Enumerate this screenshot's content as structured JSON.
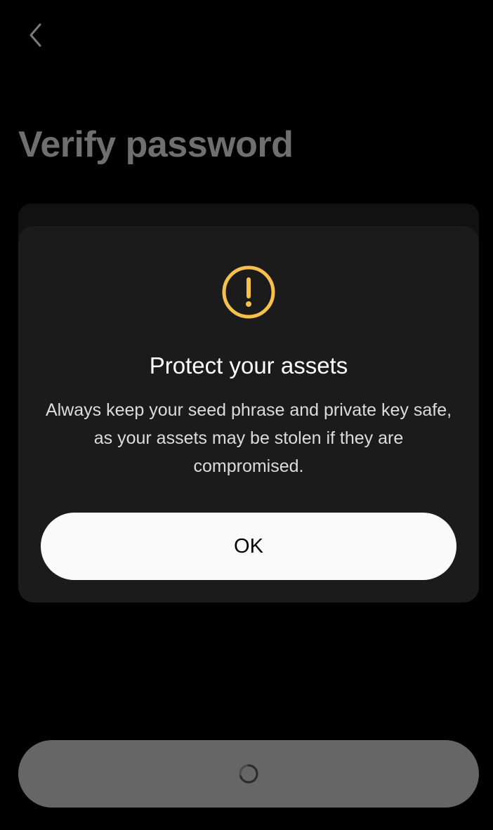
{
  "header": {
    "back_icon": "chevron-left-icon",
    "title": "Verify password"
  },
  "dialog": {
    "icon": "exclamation-circle-icon",
    "icon_color": "#F6C04F",
    "title": "Protect your assets",
    "message": "Always keep your seed phrase and private key safe, as your assets may be stolen if they are compromised.",
    "ok_label": "OK"
  },
  "footer": {
    "submit_state": "loading",
    "spinner_icon": "loading-spinner-icon"
  },
  "colors": {
    "background": "#000000",
    "dialog_background": "#1B1B1B",
    "title_dimmed": "#6F6F6F",
    "submit_disabled": "#666666"
  }
}
